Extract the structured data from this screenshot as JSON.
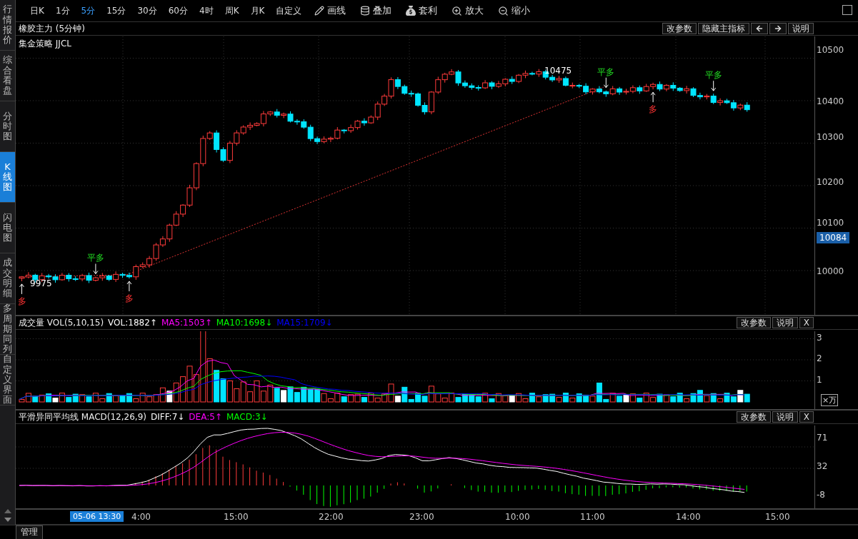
{
  "toolbar": {
    "periods": [
      {
        "label": "日K",
        "selected": false
      },
      {
        "label": "1分",
        "selected": false
      },
      {
        "label": "5分",
        "selected": true
      },
      {
        "label": "15分",
        "selected": false
      },
      {
        "label": "30分",
        "selected": false
      },
      {
        "label": "60分",
        "selected": false
      },
      {
        "label": "4时",
        "selected": false
      },
      {
        "label": "周K",
        "selected": false
      },
      {
        "label": "月K",
        "selected": false
      },
      {
        "label": "自定义",
        "selected": false
      }
    ],
    "tools": [
      {
        "kind": "draw",
        "label": "画线"
      },
      {
        "kind": "overlay",
        "label": "叠加"
      },
      {
        "kind": "arbitrage",
        "label": "套利"
      },
      {
        "kind": "zoom_in",
        "label": "放大"
      },
      {
        "kind": "zoom_out",
        "label": "缩小"
      }
    ]
  },
  "sidebar": {
    "tabs": [
      {
        "label": "行情报价",
        "selected": false
      },
      {
        "label": "综合看盘",
        "selected": false
      },
      {
        "label": "分时图",
        "selected": false
      },
      {
        "label": "K线图",
        "selected": true
      },
      {
        "label": "闪电图",
        "selected": false
      },
      {
        "label": "成交明细",
        "selected": false
      },
      {
        "label": "多周期同列",
        "selected": false
      },
      {
        "label": "自定义界面",
        "selected": false
      }
    ]
  },
  "main_chart": {
    "title": "橡胶主力 (5分钟)",
    "indicator": "集金策略 JJCL",
    "buttons": [
      {
        "kind": "text",
        "label": "改参数"
      },
      {
        "kind": "text",
        "label": "隐藏主指标"
      },
      {
        "kind": "left"
      },
      {
        "kind": "right"
      },
      {
        "kind": "text",
        "label": "说明"
      }
    ],
    "y_axis": [
      "10500",
      "10400",
      "10300",
      "10200",
      "10100",
      "10000"
    ],
    "price_tag": "10084",
    "markers": [
      {
        "kind": "close_long",
        "label": "平多"
      },
      {
        "kind": "close_long",
        "label": "平多"
      },
      {
        "kind": "price",
        "label": "10475"
      },
      {
        "kind": "long",
        "label": "多"
      },
      {
        "kind": "close_long",
        "label": "平多"
      },
      {
        "kind": "price",
        "label": "9975"
      },
      {
        "kind": "long",
        "label": "多"
      },
      {
        "kind": "long",
        "label": "多"
      }
    ]
  },
  "volume": {
    "name": "成交量 VOL(5,10,15)",
    "items": [
      {
        "label": "VOL:1882↑",
        "color": "#ffffff"
      },
      {
        "label": "MA5:1503↑",
        "color": "#ff00ff"
      },
      {
        "label": "MA10:1698↓",
        "color": "#00ff00"
      },
      {
        "label": "MA15:1709↓",
        "color": "#0000ff"
      }
    ],
    "buttons": [
      "改参数",
      "说明",
      "X"
    ],
    "y_axis": [
      "3",
      "2",
      "1"
    ],
    "unit": "×万"
  },
  "macd": {
    "name": "平滑异同平均线 MACD(12,26,9)",
    "items": [
      {
        "label": "DIFF:7↓",
        "color": "#ffffff"
      },
      {
        "label": "DEA:5↑",
        "color": "#ff00ff"
      },
      {
        "label": "MACD:3↓",
        "color": "#00ff00"
      }
    ],
    "buttons": [
      "改参数",
      "说明",
      "X"
    ],
    "y_axis": [
      "71",
      "32",
      "-8"
    ]
  },
  "time_axis": {
    "cursor": "05-06 13:30",
    "labels": [
      "4:00",
      "15:00",
      "22:00",
      "23:00",
      "10:00",
      "11:00",
      "14:00",
      "15:00"
    ]
  },
  "bottom_tabs": [
    "管理"
  ]
}
